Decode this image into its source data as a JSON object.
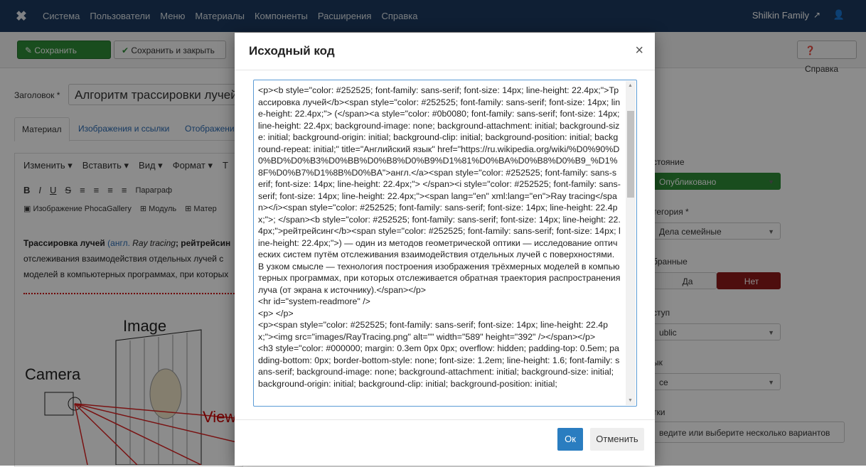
{
  "topnav": {
    "logo_icon": "joomla-logo-icon",
    "items": [
      "Система",
      "Пользователи",
      "Меню",
      "Материалы",
      "Компоненты",
      "Расширения",
      "Справка"
    ],
    "user_name": "Shilkin Family",
    "external_icon": "↗",
    "person_icon": "👤"
  },
  "toolbar": {
    "save_label": "Сохранить",
    "save_close_label": "Сохранить и закрыть",
    "help_label": "Справка"
  },
  "form": {
    "title_label": "Заголовок *",
    "title_value": "Алгоритм трассировки лучей",
    "tabs": [
      "Материал",
      "Изображения и ссылки",
      "Отображени"
    ]
  },
  "editor": {
    "menu": [
      "Изменить ▾",
      "Вставить ▾",
      "Вид ▾",
      "Формат ▾",
      "Т"
    ],
    "format_paragraph": "Параграф",
    "insert_items": [
      "Изображение PhocaGallery",
      "Модуль",
      "Матер"
    ],
    "body_lead": "Трассировка лучей",
    "body_link": "(англ.",
    "body_italic": "Ray tracing",
    "body_bold": "; рейтрейсин",
    "body_line2": "отслеживания взаимодействия отдельных лучей с",
    "body_line3": "моделей в компьютерных программах, при которых",
    "fig_image_label": "Image",
    "fig_camera_label": "Camera",
    "fig_view_label": "View F"
  },
  "right_panel": {
    "status_label": "стояние",
    "status_value": "Опубликовано",
    "category_label": "тегория *",
    "category_value": "Дела семейные",
    "featured_label": "бранные",
    "yes_label": "Да",
    "no_label": "Нет",
    "access_label": "ступ",
    "access_value": "ublic",
    "language_label": "ык",
    "language_value": "се",
    "tags_label": "тки",
    "tags_placeholder": "ведите или выберите несколько вариантов",
    "green": "#2f8d38",
    "red": "#8e1a1a"
  },
  "modal": {
    "title": "Исходный код",
    "source_code": "<p><b style=\"color: #252525; font-family: sans-serif; font-size: 14px; line-height: 22.4px;\">Трассировка лучей</b><span style=\"color: #252525; font-family: sans-serif; font-size: 14px; line-height: 22.4px;\"> (</span><a style=\"color: #0b0080; font-family: sans-serif; font-size: 14px; line-height: 22.4px; background-image: none; background-attachment: initial; background-size: initial; background-origin: initial; background-clip: initial; background-position: initial; background-repeat: initial;\" title=\"Английский язык\" href=\"https://ru.wikipedia.org/wiki/%D0%90%D0%BD%D0%B3%D0%BB%D0%B8%D0%B9%D1%81%D0%BA%D0%B8%D0%B9_%D1%8F%D0%B7%D1%8B%D0%BA\">англ.</a><span style=\"color: #252525; font-family: sans-serif; font-size: 14px; line-height: 22.4px;\"> </span><i style=\"color: #252525; font-family: sans-serif; font-size: 14px; line-height: 22.4px;\"><span lang=\"en\" xml:lang=\"en\">Ray tracing</span></i><span style=\"color: #252525; font-family: sans-serif; font-size: 14px; line-height: 22.4px;\">; </span><b style=\"color: #252525; font-family: sans-serif; font-size: 14px; line-height: 22.4px;\">рейтрейсинг</b><span style=\"color: #252525; font-family: sans-serif; font-size: 14px; line-height: 22.4px;\">) — один из методов геометрической оптики — исследование оптических систем путём отслеживания взаимодействия отдельных лучей с поверхностями. В узком смысле — технология построения изображения трёхмерных моделей в компьютерных программах, при которых отслеживается обратная траектория распространения луча (от экрана к источнику).</span></p>\n<hr id=\"system-readmore\" />\n<p> </p>\n<p><span style=\"color: #252525; font-family: sans-serif; font-size: 14px; line-height: 22.4px;\"><img src=\"images/RayTracing.png\" alt=\"\" width=\"589\" height=\"392\" /></span></p>\n<h3 style=\"color: #000000; margin: 0.3em 0px 0px; overflow: hidden; padding-top: 0.5em; padding-bottom: 0px; border-bottom-style: none; font-size: 1.2em; line-height: 1.6; font-family: sans-serif; background-image: none; background-attachment: initial; background-size: initial; background-origin: initial; background-clip: initial; background-position: initial;",
    "ok_label": "Ок",
    "cancel_label": "Отменить"
  }
}
